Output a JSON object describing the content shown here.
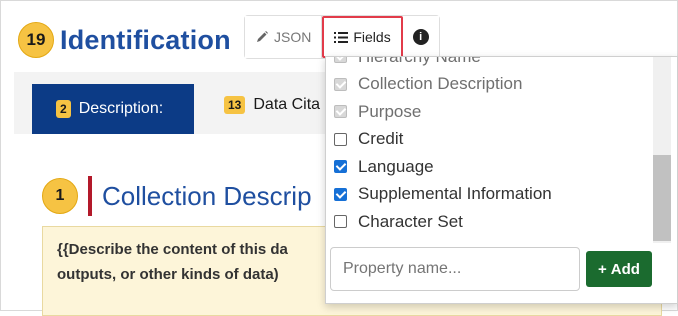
{
  "header": {
    "count": "19",
    "title": "Identification",
    "json_label": "JSON",
    "fields_label": "Fields",
    "info_label": "i"
  },
  "tabs": [
    {
      "badge": "2",
      "label": "Description:"
    },
    {
      "badge": "13",
      "label": "Data Cita"
    }
  ],
  "section": {
    "number": "1",
    "title": "Collection Descrip",
    "note_line1": "{{Describe the content of this da",
    "note_line2": "outputs, or other kinds of data)"
  },
  "dropdown": {
    "options": [
      {
        "label": "Hierarchy Name",
        "state": "disabled"
      },
      {
        "label": "Collection Description",
        "state": "disabled"
      },
      {
        "label": "Purpose",
        "state": "disabled"
      },
      {
        "label": "Credit",
        "state": "unchecked"
      },
      {
        "label": "Language",
        "state": "checked"
      },
      {
        "label": "Supplemental Information",
        "state": "checked"
      },
      {
        "label": "Character Set",
        "state": "unchecked"
      }
    ],
    "property_placeholder": "Property name...",
    "add_label": "Add",
    "add_icon": "+"
  },
  "colors": {
    "title_blue": "#1f4fa0",
    "badge_yellow": "#f6c343",
    "tab_active": "#0c3b86",
    "fields_highlight": "#e23b4a",
    "add_green": "#1b6b2f",
    "checkbox_blue": "#1670d6"
  }
}
